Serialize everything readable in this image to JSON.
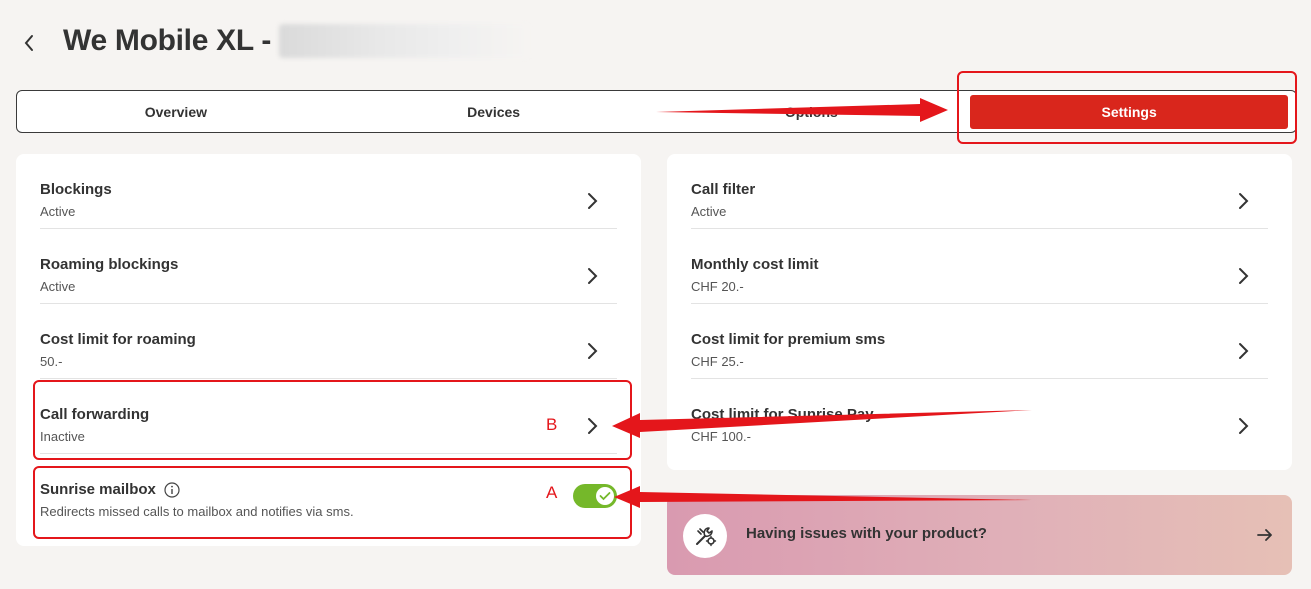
{
  "header": {
    "back_icon": "chevron-left-icon",
    "title": "We Mobile XL -"
  },
  "tabs": [
    {
      "label": "Overview",
      "active": false
    },
    {
      "label": "Devices",
      "active": false
    },
    {
      "label": "Options",
      "active": false
    },
    {
      "label": "Settings",
      "active": true
    }
  ],
  "left_card": {
    "rows": [
      {
        "title": "Blockings",
        "subtitle": "Active"
      },
      {
        "title": "Roaming blockings",
        "subtitle": "Active"
      },
      {
        "title": "Cost limit for roaming",
        "subtitle": "50.-"
      },
      {
        "title": "Call forwarding",
        "subtitle": "Inactive"
      }
    ],
    "mailbox": {
      "title": "Sunrise mailbox",
      "subtitle": "Redirects missed calls to mailbox and notifies via sms.",
      "toggle_on": true
    }
  },
  "right_card": {
    "rows": [
      {
        "title": "Call filter",
        "subtitle": "Active"
      },
      {
        "title": "Monthly cost limit",
        "subtitle": "CHF 20.-"
      },
      {
        "title": "Cost limit for premium sms",
        "subtitle": "CHF 25.-"
      },
      {
        "title": "Cost limit for Sunrise Pay",
        "subtitle": "CHF 100.-"
      }
    ]
  },
  "help": {
    "text": "Having issues with your product?",
    "icon": "tools-icon",
    "arrow_icon": "arrow-right-icon"
  },
  "annotations": {
    "label_a": "A",
    "label_b": "B",
    "color": "#e4161b"
  },
  "colors": {
    "brand_red": "#d9261c",
    "toggle_green": "#75b82a"
  }
}
